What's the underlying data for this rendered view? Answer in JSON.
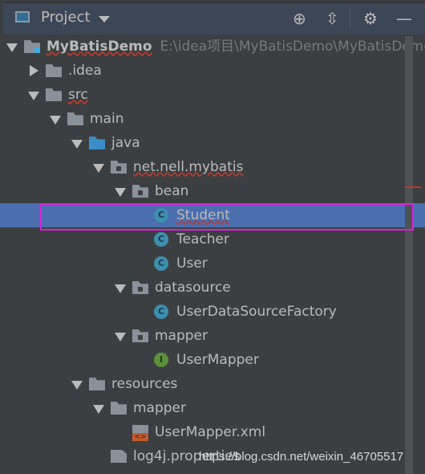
{
  "header": {
    "title": "Project",
    "icons": [
      "project-window-icon",
      "locate-icon",
      "collapse-all-icon",
      "gear-icon",
      "minimize-icon"
    ]
  },
  "tree": [
    {
      "depth": 0,
      "arrow": "open",
      "icon": "module",
      "label": "MyBatisDemo",
      "path": "E:\\idea项目\\MyBatisDemo\\MyBatisDemo",
      "bold": true,
      "squiggle": true
    },
    {
      "depth": 1,
      "arrow": "closed",
      "icon": "folder",
      "label": ".idea"
    },
    {
      "depth": 1,
      "arrow": "open",
      "icon": "folder",
      "label": "src",
      "squiggle": true
    },
    {
      "depth": 2,
      "arrow": "open",
      "icon": "folder",
      "label": "main"
    },
    {
      "depth": 3,
      "arrow": "open",
      "icon": "folder-blue",
      "label": "java"
    },
    {
      "depth": 4,
      "arrow": "open",
      "icon": "package",
      "label": "net.nell.mybatis",
      "squiggle": true
    },
    {
      "depth": 5,
      "arrow": "open",
      "icon": "package",
      "label": "bean"
    },
    {
      "depth": 6,
      "arrow": "none",
      "icon": "class",
      "label": "Student",
      "selected": true,
      "squiggle": true
    },
    {
      "depth": 6,
      "arrow": "none",
      "icon": "class",
      "label": "Teacher"
    },
    {
      "depth": 6,
      "arrow": "none",
      "icon": "class",
      "label": "User"
    },
    {
      "depth": 5,
      "arrow": "open",
      "icon": "package",
      "label": "datasource"
    },
    {
      "depth": 6,
      "arrow": "none",
      "icon": "class",
      "label": "UserDataSourceFactory"
    },
    {
      "depth": 5,
      "arrow": "open",
      "icon": "package",
      "label": "mapper"
    },
    {
      "depth": 6,
      "arrow": "none",
      "icon": "interface",
      "label": "UserMapper"
    },
    {
      "depth": 3,
      "arrow": "open",
      "icon": "resources",
      "label": "resources"
    },
    {
      "depth": 4,
      "arrow": "open",
      "icon": "folder",
      "label": "mapper"
    },
    {
      "depth": 5,
      "arrow": "none",
      "icon": "xml",
      "label": "UserMapper.xml"
    },
    {
      "depth": 4,
      "arrow": "none",
      "icon": "properties",
      "label": "log4j.properties"
    }
  ],
  "watermark": "https://blog.csdn.net/weixin_46705517",
  "colors": {
    "selection": "#4b6eaf",
    "highlight_box": "#e11ee1",
    "background": "#3c3f41"
  }
}
